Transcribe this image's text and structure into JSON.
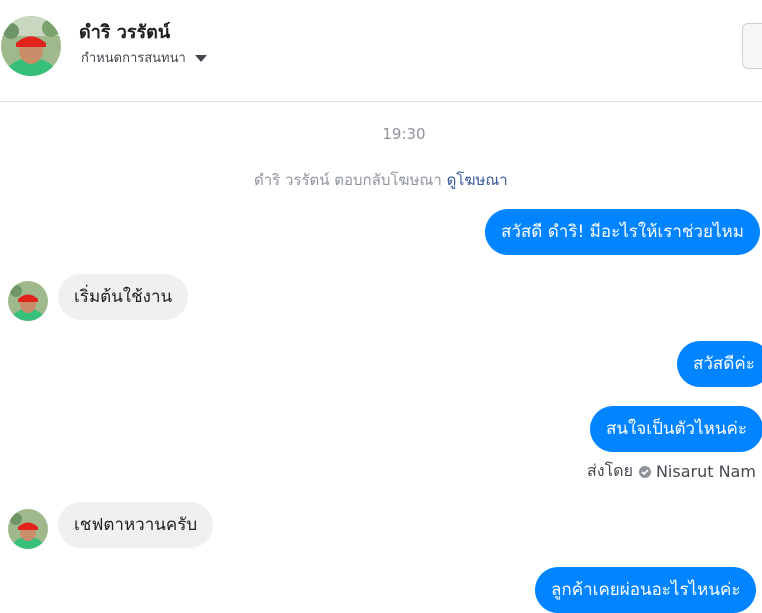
{
  "header": {
    "name": "ดำริ วรรัตน์",
    "subtitle": "กำหนดการสนทนา"
  },
  "thread": {
    "time": "19:30",
    "ad_note": "ดำริ วรรัตน์ ตอบกลับโฆษณา",
    "ad_link": "ดูโฆษณา",
    "messages": [
      {
        "side": "out",
        "text": "สวัสดี ดำริ! มีอะไรให้เราช่วยไหม"
      },
      {
        "side": "in",
        "text": "เริ่มต้นใช้งาน"
      },
      {
        "side": "out",
        "text": "สวัสดีค่ะ"
      },
      {
        "side": "out",
        "text": "สนใจเป็นตัวไหนค่ะ"
      },
      {
        "side": "in",
        "text": "เชฟตาหวานครับ"
      },
      {
        "side": "out",
        "text": "ลูกค้าเคยผ่อนอะไรไหนค่ะ"
      }
    ],
    "sent_by_label": "ส่งโดย",
    "sent_by_agent": "Nisarut Nam"
  }
}
